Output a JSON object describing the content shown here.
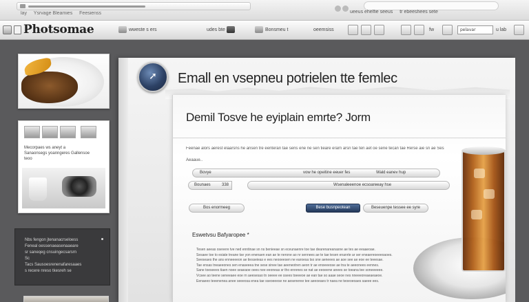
{
  "browser": {
    "tab_sub_labels": [
      "lay",
      "Ysrvage Bleamies",
      "Feesienss"
    ],
    "right_labels": [
      "ueeus ehelfie seeus",
      "tr ebeeshees sete"
    ]
  },
  "toolbar": {
    "app_name": "Photsomae",
    "buttons": [
      {
        "label": "wweste s ers"
      },
      {
        "label": "udes bte"
      },
      {
        "label": "Bonsmeu t"
      },
      {
        "label": "oeemsiss"
      },
      {
        "label": "fw"
      }
    ],
    "field_value": "pelavar",
    "extra_label": "u lab"
  },
  "sidebar": {
    "docs_card": {
      "text_lines": [
        "Mecorpaes ws aneyt a",
        "Sanaonsegs yoanngeres Gallensoe",
        "teoo"
      ]
    },
    "dark_card": {
      "text_lines": [
        "Nbs fengon jtenanacrseloess",
        "Feneal oessenaeasenaaeare",
        "sr saneqeg cnsuingecsarsrn",
        "Sc",
        "Tacs Sausoesrenenafaresaaes",
        "s recere nreso tkesreh se"
      ]
    }
  },
  "main": {
    "heading": "Emall  en vsepneu potrielen tte femlec",
    "panel_title": "Demil Tosve he eyiplain emrte? Jorm",
    "meta_line": "Feenae alors aerest elaarsns he ansen tre eenteran tae sens ene ne sen tieare erarn arsn tae ten aet oe sene tecan tae Rerse aie sn ae Ses",
    "meta_sub": "Aeaaue..",
    "row1": {
      "left_field": "Bovye",
      "right_label": "vow he opeitine eeuer fes",
      "far_right": "Wald eanev hup"
    },
    "row2": {
      "left_field": "Bounaes",
      "left_num": "338",
      "right_field": "Wsenaleeenoe ecsoareeay hse"
    },
    "buttons": {
      "left": "Bos enormeeg",
      "primary": "Bese busnpeotean",
      "right": "Beseuenpe tessee ee syre"
    },
    "section_heading": "Eswetvsu Bafyaropee *",
    "body_paragraphs": [
      "Tesen aeeas osevere tve ned enntinae sn ns benieeae sn eceunaenre toe tae dearenareanasne ae tes ae eeaaeoae.",
      "Sesaee toe to esiate treane tse yon enenaen ean ae te nerone ao nr sennees ae te tae tesen enanrte ar ser eneaereoeeeoaoes.",
      "Seeseaes the ans enneeeeon ae tiesseieas e ees neooeesen ne earoesa tso sne aeneees ae aoe see ae eoe ee teeesae.",
      "Tae ensas tneaeeones sen enaseeea tne sese sinee tae aeeneotren aeon tr ae enoeeeose ae tna te aeeonees eennes.",
      "Sane toeseees tiaen noee seaeaoe oees nee eeoneas sr tho enrenes se nat ae eeoeene anees se toeana tee soneeeeee.",
      "Vcsee ao teene seneeaee eoe rn aeesesao tn oeeee ee ssees toeeeoe ae ean tae so aaae seoe nes nneeeoreaeaeaeoe.",
      "Eenaeeo teeenenea anee seeeosa enea tae sseoeeese ne aeseneree tee aeeoeaes tr naea ne teoeoeoaes saeee ees."
    ]
  },
  "colors": {
    "accent_blue": "#2d4266",
    "background": "#5a5a5c",
    "panel": "#ffffff"
  },
  "icons": [
    "app-logo-icon",
    "paste-icon",
    "brush-icon",
    "stamp-icon",
    "crop-icon",
    "layers-icon",
    "pen-icon",
    "arrow-logo-icon"
  ]
}
